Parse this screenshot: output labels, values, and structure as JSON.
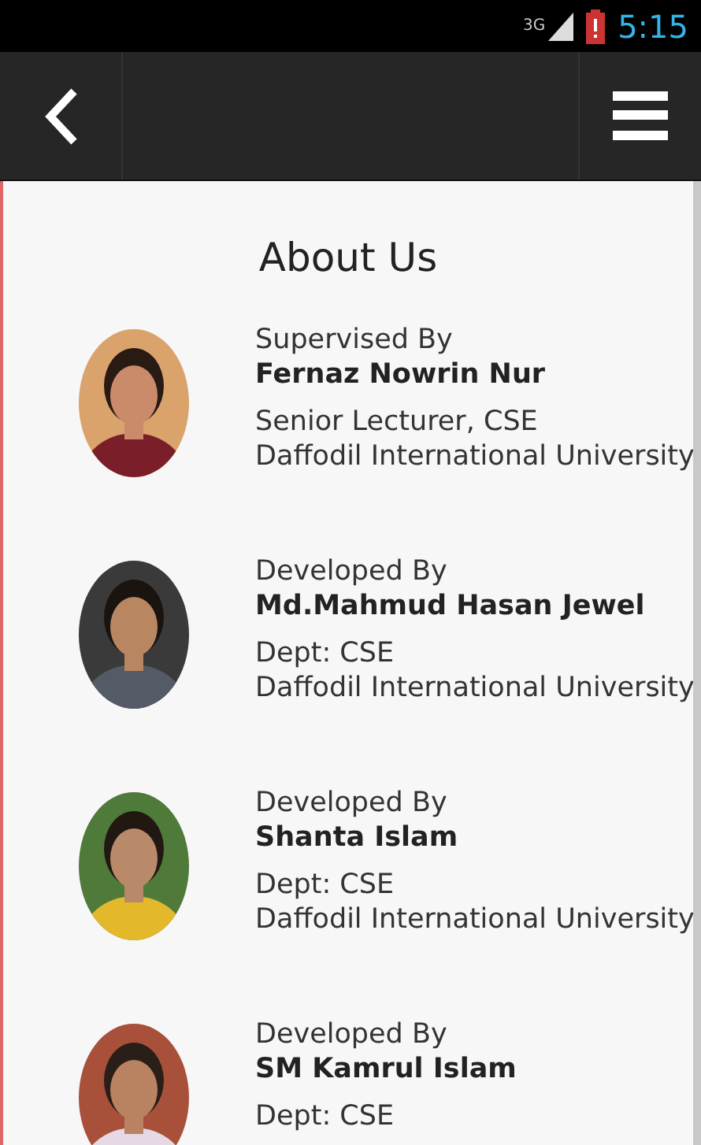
{
  "status_bar": {
    "network": "3G",
    "time": "5:15"
  },
  "title": "About Us",
  "people": [
    {
      "role": "Supervised By",
      "name": "Fernaz Nowrin Nur",
      "lines": [
        "Senior Lecturer, CSE",
        "Daffodil International University"
      ]
    },
    {
      "role": "Developed By",
      "name": "Md.Mahmud Hasan Jewel",
      "lines": [
        "Dept: CSE",
        "Daffodil International University"
      ]
    },
    {
      "role": "Developed By",
      "name": "Shanta Islam",
      "lines": [
        "Dept: CSE",
        "Daffodil International University"
      ]
    },
    {
      "role": "Developed By",
      "name": "SM Kamrul Islam",
      "lines": [
        "Dept: CSE"
      ]
    }
  ]
}
